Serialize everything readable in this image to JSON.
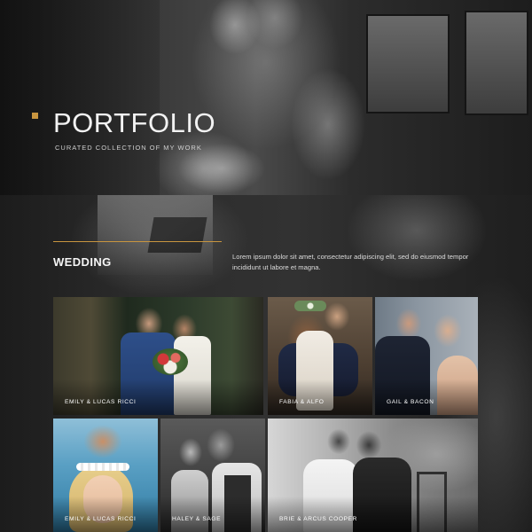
{
  "hero": {
    "title": "PORTFOLIO",
    "subtitle": "CURATED COLLECTION OF MY WORK",
    "accent_color": "#c8953f"
  },
  "section": {
    "title": "WEDDING",
    "description": "Lorem ipsum dolor sit amet, consectetur adipiscing elit, sed do eiusmod tempor incididunt ut labore et magna.",
    "rule_color": "#c8953f"
  },
  "gallery": [
    {
      "caption": "EMILY & LUCAS RICCI"
    },
    {
      "caption": "FABIA & ALFO"
    },
    {
      "caption": "GAIL & BACON"
    },
    {
      "caption": "EMILY & LUCAS RICCI"
    },
    {
      "caption": "HALEY & SAGE"
    },
    {
      "caption": "BRIE & ARCUS COOPER"
    }
  ]
}
